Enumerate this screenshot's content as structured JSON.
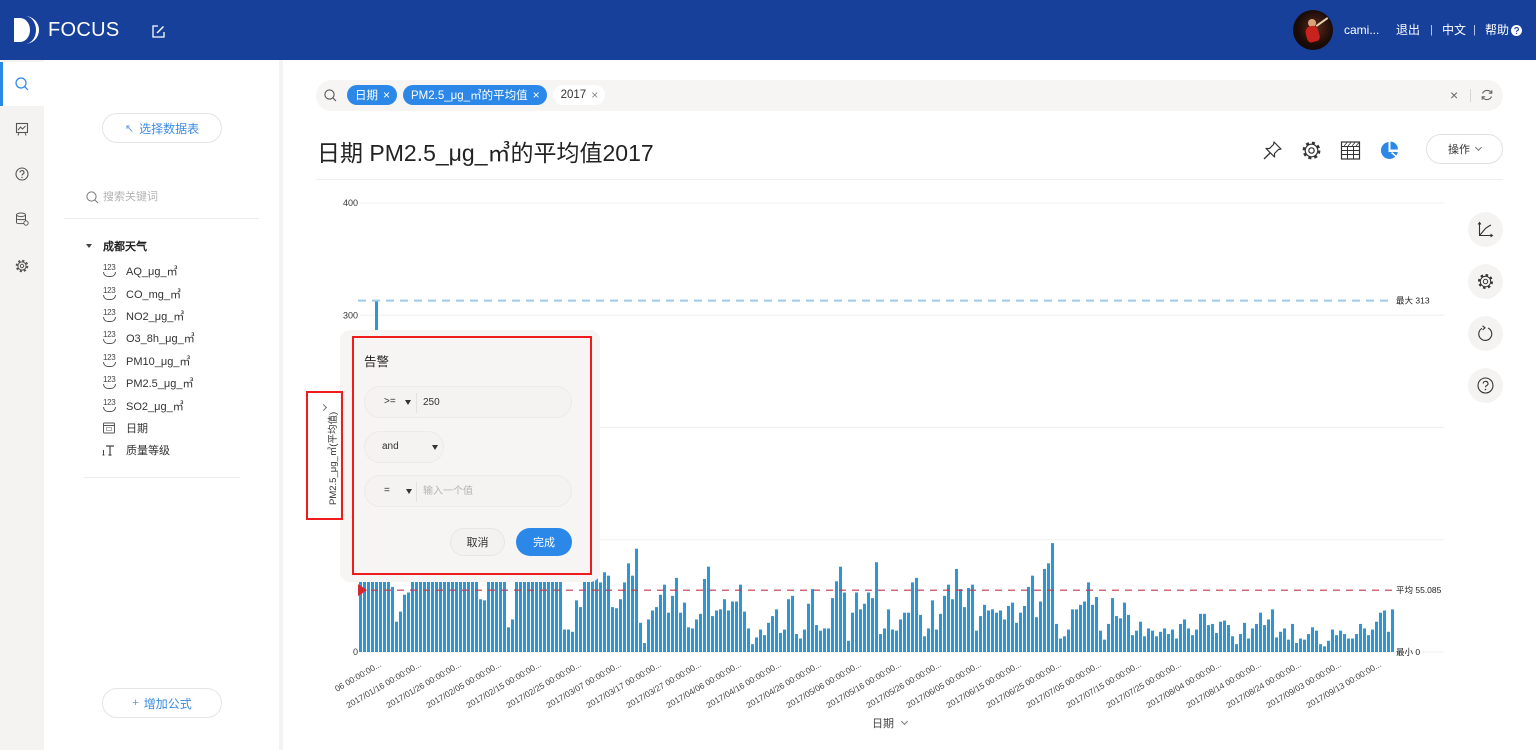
{
  "header": {
    "app_name": "FOCUS",
    "username": "cami...",
    "logout": "退出",
    "separator": "|",
    "language": "中文",
    "help": "帮助"
  },
  "rail": {
    "items": [
      "search",
      "dashboard",
      "help",
      "database",
      "settings"
    ],
    "active": "search"
  },
  "sidebar": {
    "select_table_label": "选择数据表",
    "select_table_glyph": "↖",
    "search_placeholder": "搜索关键词",
    "tree_root": "成都天气",
    "fields": [
      {
        "label": "AQ_μg_㎥",
        "type": "number"
      },
      {
        "label": "CO_mg_㎥",
        "type": "number"
      },
      {
        "label": "NO2_μg_㎥",
        "type": "number"
      },
      {
        "label": "O3_8h_μg_㎥",
        "type": "number"
      },
      {
        "label": "PM10_μg_㎥",
        "type": "number"
      },
      {
        "label": "PM2.5_μg_㎥",
        "type": "number"
      },
      {
        "label": "SO2_μg_㎥",
        "type": "number"
      },
      {
        "label": "日期",
        "type": "date"
      },
      {
        "label": "质量等级",
        "type": "text"
      }
    ],
    "add_formula_label": "增加公式",
    "add_formula_glyph": "+"
  },
  "search_bar": {
    "tokens": [
      {
        "label": "日期",
        "style": "filled"
      },
      {
        "label": "PM2.5_μg_㎥的平均值",
        "style": "filled"
      },
      {
        "label": "2017",
        "style": "plain"
      }
    ]
  },
  "page_title": "日期 PM2.5_μg_㎥的平均值2017",
  "toolbar": {
    "icons": [
      "pin",
      "settings",
      "table-view",
      "pie-chart"
    ],
    "active_view": "pie-chart",
    "actions_label": "操作"
  },
  "side_tools": [
    "axis-settings",
    "chart-settings",
    "refresh",
    "help"
  ],
  "y_axis_title": "PM2.5_μg_㎥(平均值)",
  "x_axis_title": "日期",
  "alert_popup": {
    "title": "告警",
    "condition1": {
      "operator": ">=",
      "value": "250"
    },
    "logic": "and",
    "condition2": {
      "operator": "=",
      "value": "",
      "placeholder": "输入一个值"
    },
    "cancel_label": "取消",
    "done_label": "完成"
  },
  "colors": {
    "header": "#17409a",
    "accent": "#2b87e8",
    "bar": "#2e96d8",
    "max_line": "#9ccbe9",
    "avg_line": "#c0394b",
    "alert_marker": "#d9252d",
    "highlight": "#ee1c1c"
  },
  "chart_data": {
    "type": "bar",
    "title": "日期 PM2.5_μg_㎥的平均值2017",
    "xlabel": "日期",
    "ylabel": "PM2.5_μg_㎥(平均值)",
    "x_start": "2017/01/01",
    "x_step_days": 1,
    "ylim": [
      0,
      400
    ],
    "y_ticks": [
      0,
      100,
      200,
      300,
      400
    ],
    "y_tick_labels": [
      "0",
      "100",
      "200",
      "300",
      "400"
    ],
    "grid": true,
    "x_tick_first_index": 5,
    "x_tick_every": 10,
    "x_tick_labels": [
      "06 00:00:00...",
      "2017/01/16 00:00:00...",
      "2017/01/26 00:00:00...",
      "2017/02/05 00:00:00...",
      "2017/02/15 00:00:00...",
      "2017/02/25 00:00:00...",
      "2017/03/07 00:00:00...",
      "2017/03/17 00:00:00...",
      "2017/03/27 00:00:00...",
      "2017/04/06 00:00:00...",
      "2017/04/16 00:00:00...",
      "2017/04/26 00:00:00...",
      "2017/05/06 00:00:00...",
      "2017/05/16 00:00:00...",
      "2017/05/26 00:00:00...",
      "2017/06/05 00:00:00...",
      "2017/06/15 00:00:00...",
      "2017/06/25 00:00:00...",
      "2017/07/05 00:00:00...",
      "2017/07/15 00:00:00...",
      "2017/07/25 00:00:00...",
      "2017/08/04 00:00:00...",
      "2017/08/14 00:00:00...",
      "2017/08/24 00:00:00...",
      "2017/09/03 00:00:00...",
      "2017/09/13 00:00:00..."
    ],
    "reference_lines": [
      {
        "name": "最大",
        "value": 313,
        "label": "最大 313",
        "style": "max"
      },
      {
        "name": "平均",
        "value": 55.085,
        "label": "平均 55.085",
        "style": "avg"
      },
      {
        "name": "最小",
        "value": 0,
        "label": "最小 0",
        "style": "min"
      }
    ],
    "alert_marker_value": 55.085,
    "values": [
      150,
      185,
      230,
      270,
      313,
      210,
      140,
      105,
      58,
      27,
      36,
      51,
      53,
      120,
      155,
      180,
      135,
      170,
      210,
      245,
      195,
      145,
      125,
      160,
      190,
      225,
      175,
      140,
      110,
      130,
      47,
      46,
      125,
      150,
      175,
      140,
      115,
      22,
      29,
      95,
      120,
      135,
      105,
      125,
      145,
      110,
      90,
      115,
      130,
      120,
      100,
      20,
      20,
      18,
      46,
      40,
      65,
      66,
      70,
      79,
      62,
      71,
      68,
      40,
      39,
      47,
      62,
      79,
      68,
      92,
      26,
      8,
      29,
      37,
      40,
      51,
      60,
      35,
      50,
      66,
      35,
      44,
      22,
      21,
      29,
      34,
      65,
      76,
      32,
      37,
      38,
      47,
      37,
      45,
      45,
      60,
      36,
      21,
      7,
      13,
      20,
      15,
      26,
      32,
      38,
      17,
      20,
      47,
      50,
      16,
      12,
      20,
      43,
      56,
      24,
      19,
      21,
      21,
      48,
      63,
      76,
      53,
      10,
      35,
      53,
      38,
      43,
      53,
      48,
      80,
      16,
      21,
      38,
      20,
      19,
      29,
      35,
      35,
      62,
      66,
      33,
      14,
      21,
      46,
      20,
      34,
      50,
      60,
      47,
      74,
      56,
      40,
      57,
      60,
      19,
      32,
      42,
      37,
      38,
      35,
      37,
      29,
      41,
      44,
      26,
      35,
      41,
      58,
      68,
      31,
      45,
      74,
      79,
      97,
      25,
      12,
      14,
      20,
      38,
      38,
      42,
      45,
      62,
      42,
      49,
      19,
      11,
      25,
      48,
      32,
      30,
      44,
      33,
      15,
      19,
      27,
      14,
      21,
      19,
      14,
      18,
      21,
      16,
      20,
      12,
      25,
      29,
      21,
      15,
      20,
      34,
      34,
      24,
      25,
      17,
      27,
      28,
      24,
      14,
      7,
      16,
      26,
      12,
      21,
      25,
      35,
      24,
      29,
      38,
      13,
      18,
      21,
      11,
      25,
      8,
      12,
      11,
      16,
      22,
      19,
      7,
      5,
      10,
      20,
      15,
      19,
      16,
      12,
      12,
      16,
      25,
      21,
      15,
      20,
      27,
      35,
      37,
      18,
      38
    ]
  }
}
